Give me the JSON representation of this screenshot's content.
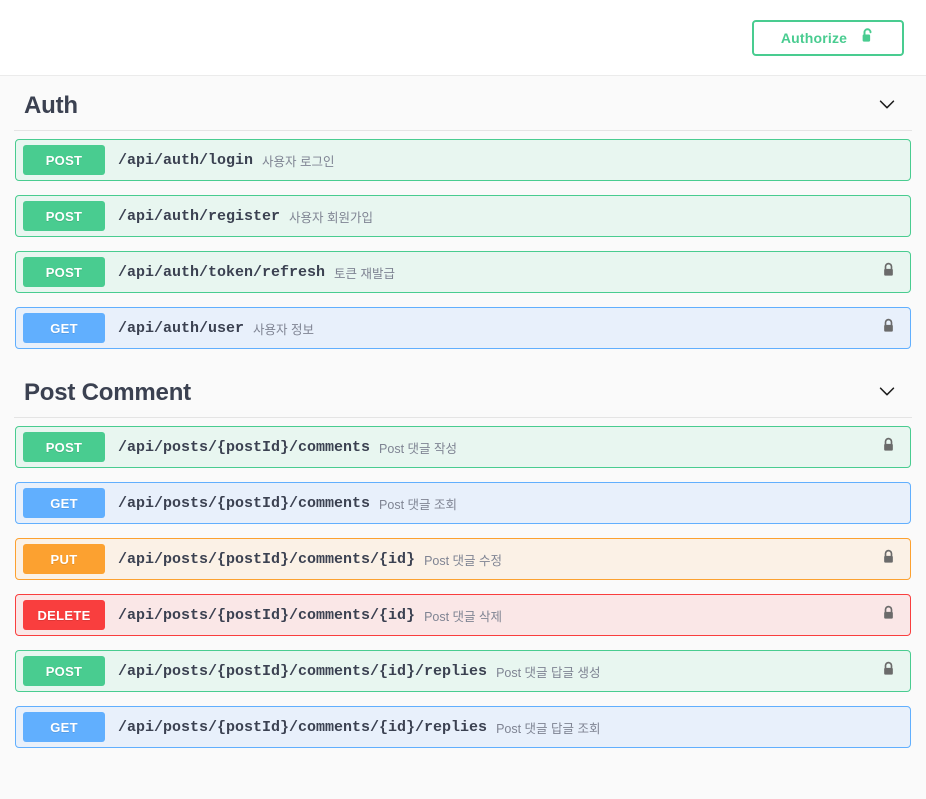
{
  "topbar": {
    "authorize_label": "Authorize",
    "authorize_icon": "unlock-icon"
  },
  "colors": {
    "post": "#49cc90",
    "get": "#61affe",
    "put": "#fca130",
    "delete": "#f93e3e",
    "post_bg": "#e8f6f0",
    "get_bg": "#e8f0fb",
    "put_bg": "#fbf1e6",
    "delete_bg": "#fae7e7",
    "title": "#3b4151",
    "description": "#7f8493",
    "page_bg": "#fafafa",
    "lock": "#6b6b6b"
  },
  "sections": [
    {
      "title": "Auth",
      "collapse_icon": "chevron-down-icon",
      "operations": [
        {
          "method": "POST",
          "method_class": "post",
          "path": "/api/auth/login",
          "description": "사용자 로그인",
          "locked": false
        },
        {
          "method": "POST",
          "method_class": "post",
          "path": "/api/auth/register",
          "description": "사용자 회원가입",
          "locked": false
        },
        {
          "method": "POST",
          "method_class": "post",
          "path": "/api/auth/token/refresh",
          "description": "토큰 재발급",
          "locked": true
        },
        {
          "method": "GET",
          "method_class": "get",
          "path": "/api/auth/user",
          "description": "사용자 정보",
          "locked": true
        }
      ]
    },
    {
      "title": "Post Comment",
      "collapse_icon": "chevron-down-icon",
      "operations": [
        {
          "method": "POST",
          "method_class": "post",
          "path": "/api/posts/{postId}/comments",
          "description": "Post 댓글 작성",
          "locked": true
        },
        {
          "method": "GET",
          "method_class": "get",
          "path": "/api/posts/{postId}/comments",
          "description": "Post 댓글 조회",
          "locked": false
        },
        {
          "method": "PUT",
          "method_class": "put",
          "path": "/api/posts/{postId}/comments/{id}",
          "description": "Post 댓글 수정",
          "locked": true
        },
        {
          "method": "DELETE",
          "method_class": "delete",
          "path": "/api/posts/{postId}/comments/{id}",
          "description": "Post 댓글 삭제",
          "locked": true
        },
        {
          "method": "POST",
          "method_class": "post",
          "path": "/api/posts/{postId}/comments/{id}/replies",
          "description": "Post 댓글 답글 생성",
          "locked": true
        },
        {
          "method": "GET",
          "method_class": "get",
          "path": "/api/posts/{postId}/comments/{id}/replies",
          "description": "Post 댓글 답글 조회",
          "locked": false
        }
      ]
    }
  ]
}
